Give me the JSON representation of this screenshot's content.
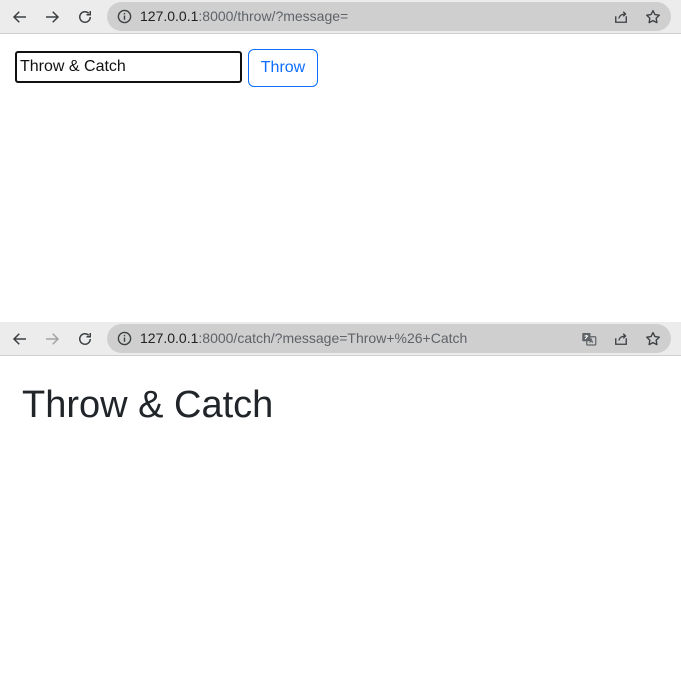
{
  "top_window": {
    "address_bar": {
      "host": "127.0.0.1",
      "rest": ":8000/throw/?message="
    },
    "form": {
      "input_value": "Throw & Catch",
      "button_label": "Throw"
    }
  },
  "bottom_window": {
    "address_bar": {
      "host": "127.0.0.1",
      "rest": ":8000/catch/?message=Throw+%26+Catch"
    },
    "heading": "Throw & Catch"
  },
  "icons": {
    "back": "arrow-left-icon",
    "forward": "arrow-right-icon",
    "reload": "reload-icon",
    "info": "info-icon",
    "translate": "translate-icon",
    "share": "share-icon",
    "star": "star-icon"
  },
  "colors": {
    "toolbar_bg": "#ececec",
    "omnibox_bg": "#cfcfcf",
    "button_accent": "#0d6efd",
    "text": "#212529"
  }
}
